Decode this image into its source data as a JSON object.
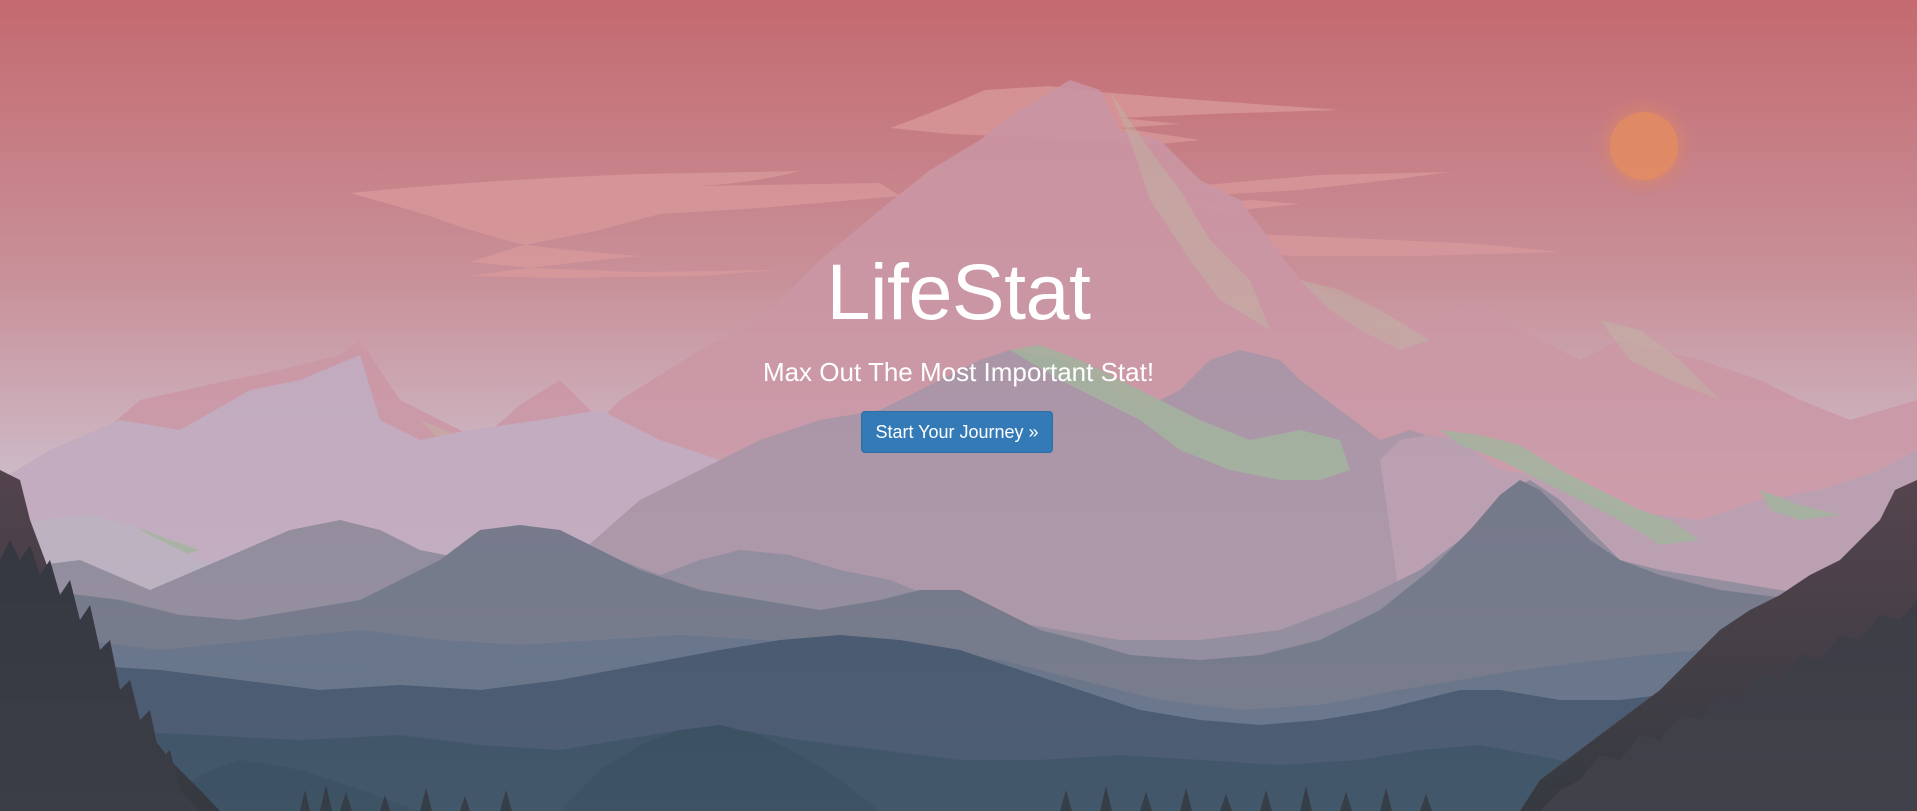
{
  "hero": {
    "title": "LifeStat",
    "tagline": "Max Out The Most Important Stat!",
    "cta_label": "Start Your Journey »"
  },
  "colors": {
    "sky_top": "#c46a6f",
    "sky_bottom": "#cbb9c6",
    "sun": "#e08863",
    "button": "#337ab7",
    "text": "#ffffff"
  }
}
